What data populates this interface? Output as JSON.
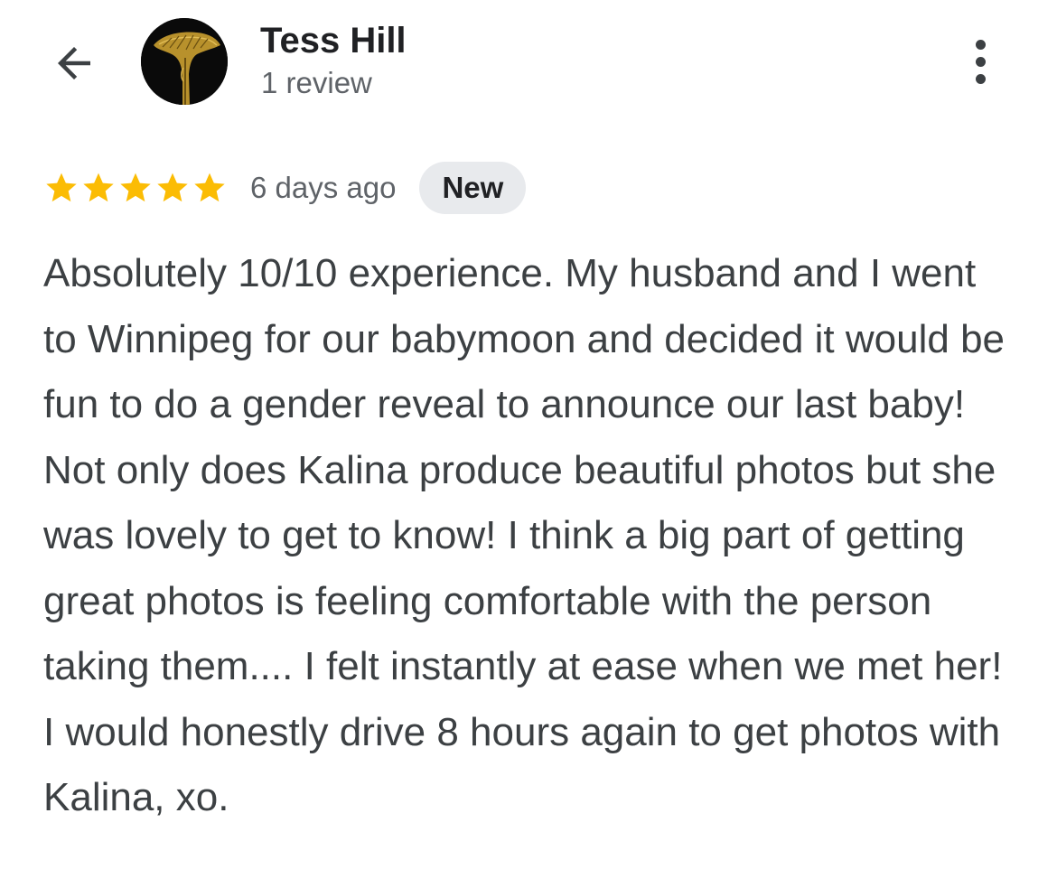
{
  "reviewer": {
    "name": "Tess Hill",
    "review_count": "1 review",
    "avatar_icon": "avatar-image"
  },
  "header": {
    "back_icon": "arrow-left-icon",
    "more_icon": "more-vertical-icon"
  },
  "review": {
    "rating": 5,
    "max_rating": 5,
    "star_color": "#fbbc04",
    "time_ago": "6 days ago",
    "badge": "New",
    "text": "Absolutely 10/10 experience. My husband and I went to Winnipeg for our babymoon and decided it would be fun to do a gender reveal to announce our last baby! Not only does Kalina produce beautiful photos but she was lovely to get to know! I think a big part of getting great photos is feeling comfortable with the person taking them.... I felt instantly at ease when we met her! I would honestly drive 8 hours again to get photos with Kalina, xo."
  },
  "colors": {
    "text_primary": "#202124",
    "text_secondary": "#5f6368",
    "badge_bg": "#e8eaed"
  }
}
